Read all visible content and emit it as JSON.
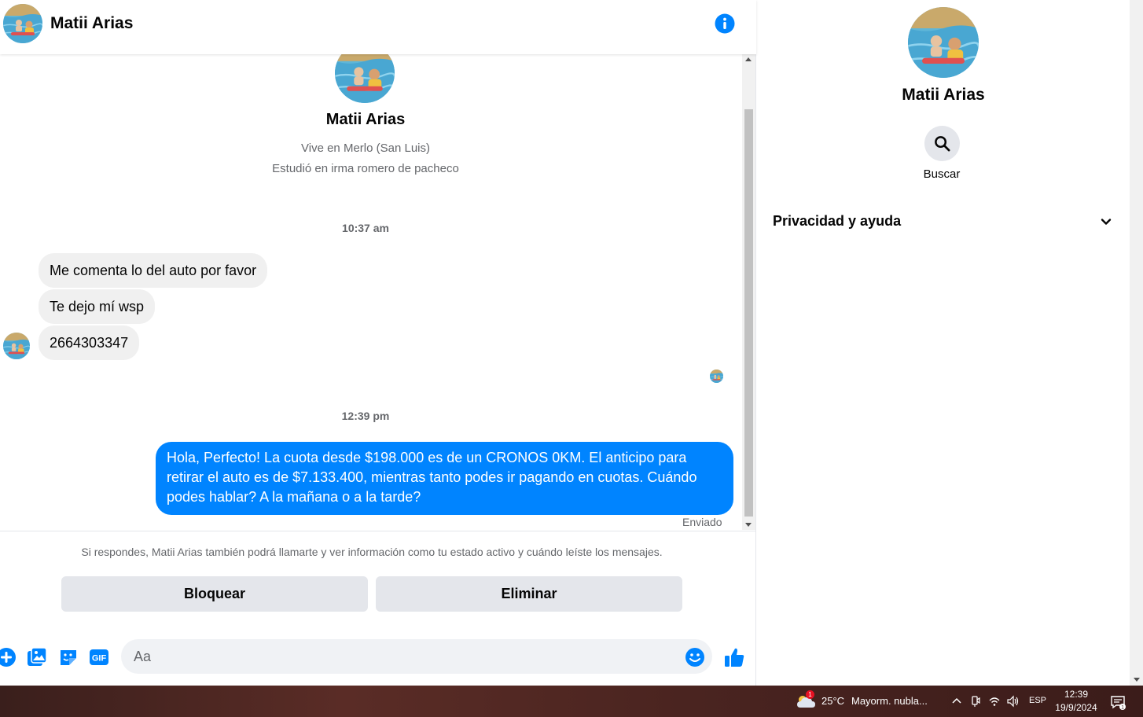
{
  "header": {
    "name": "Matii Arias"
  },
  "profile": {
    "name": "Matii Arias",
    "lines": [
      "Vive en Merlo (San Luis)",
      "Estudió en irma romero de pacheco"
    ]
  },
  "conversation": {
    "timestamp_1": "10:37 am",
    "incoming": [
      "Me comenta lo del auto por favor",
      "Te dejo mí wsp",
      "2664303347"
    ],
    "timestamp_2": "12:39 pm",
    "outgoing": "Hola, Perfecto! La cuota desde $198.000 es de un CRONOS 0KM. El anticipo para retirar el auto es de $7.133.400, mientras tanto podes ir pagando en cuotas. Cuándo podes hablar? A la mañana o a la tarde?",
    "sent_status": "Enviado"
  },
  "request_notice": "Si respondes, Matii Arias también podrá llamarte y ver información como tu estado activo y cuándo leíste los mensajes.",
  "actions": {
    "block": "Bloquear",
    "delete": "Eliminar"
  },
  "composer": {
    "placeholder": "Aa",
    "icons": [
      "plus-icon",
      "image-icon",
      "sticker-icon",
      "gif-icon",
      "emoji-icon",
      "like-icon"
    ],
    "gif_text": "GIF"
  },
  "side_panel": {
    "name": "Matii Arias",
    "search_label": "Buscar",
    "privacy_label": "Privacidad y ayuda"
  },
  "taskbar": {
    "weather_badge": "1",
    "temperature": "25°C",
    "weather": "Mayorm. nubla...",
    "language": "ESP",
    "time": "12:39",
    "date": "19/9/2024",
    "notification_count": "1"
  },
  "colors": {
    "accent": "#0084ff",
    "bubble_in": "#f0f0f0",
    "button": "#e4e6eb"
  }
}
